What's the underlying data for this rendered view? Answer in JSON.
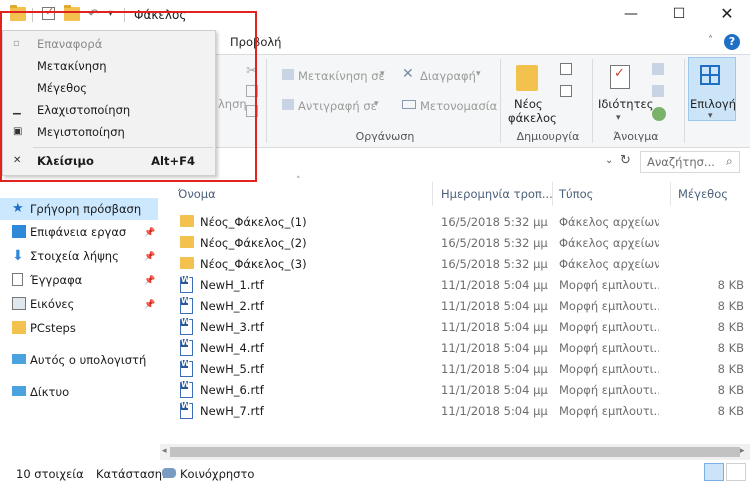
{
  "window": {
    "title": "Φάκελος"
  },
  "tabs": {
    "view": "Προβολή"
  },
  "ribbon": {
    "move_to": "Μετακίνηση σε",
    "copy_to": "Αντιγραφή σε",
    "delete": "Διαγραφή",
    "rename": "Μετονομασία",
    "organize": "Οργάνωση",
    "new_folder_l1": "Νέος",
    "new_folder_l2": "φάκελος",
    "create": "Δημιουργία",
    "properties": "Ιδιότητες",
    "open": "Άνοιγμα",
    "select": "Επιλογή",
    "partial_label": "ληση"
  },
  "search": {
    "placeholder": "Αναζήτησ..."
  },
  "nav": {
    "quick_access": "Γρήγορη πρόσβαση",
    "items": [
      {
        "label": "Επιφάνεια εργασ"
      },
      {
        "label": "Στοιχεία λήψης"
      },
      {
        "label": "Έγγραφα"
      },
      {
        "label": "Εικόνες"
      },
      {
        "label": "PCsteps"
      }
    ],
    "this_pc": "Αυτός ο υπολογιστή",
    "network": "Δίκτυο"
  },
  "columns": {
    "name": "Όνομα",
    "date": "Ημερομηνία τροπ...",
    "type": "Τύπος",
    "size": "Μέγεθος"
  },
  "files": [
    {
      "name": "Νέος_Φάκελος_(1)",
      "date": "16/5/2018 5:32 μμ",
      "type": "Φάκελος αρχείων",
      "size": "",
      "kind": "folder"
    },
    {
      "name": "Νέος_Φάκελος_(2)",
      "date": "16/5/2018 5:32 μμ",
      "type": "Φάκελος αρχείων",
      "size": "",
      "kind": "folder"
    },
    {
      "name": "Νέος_Φάκελος_(3)",
      "date": "16/5/2018 5:32 μμ",
      "type": "Φάκελος αρχείων",
      "size": "",
      "kind": "folder"
    },
    {
      "name": "NewH_1.rtf",
      "date": "11/1/2018 5:04 μμ",
      "type": "Μορφή εμπλουτι...",
      "size": "8 KB",
      "kind": "rtf"
    },
    {
      "name": "NewH_2.rtf",
      "date": "11/1/2018 5:04 μμ",
      "type": "Μορφή εμπλουτι...",
      "size": "8 KB",
      "kind": "rtf"
    },
    {
      "name": "NewH_3.rtf",
      "date": "11/1/2018 5:04 μμ",
      "type": "Μορφή εμπλουτι...",
      "size": "8 KB",
      "kind": "rtf"
    },
    {
      "name": "NewH_4.rtf",
      "date": "11/1/2018 5:04 μμ",
      "type": "Μορφή εμπλουτι...",
      "size": "8 KB",
      "kind": "rtf"
    },
    {
      "name": "NewH_5.rtf",
      "date": "11/1/2018 5:04 μμ",
      "type": "Μορφή εμπλουτι...",
      "size": "8 KB",
      "kind": "rtf"
    },
    {
      "name": "NewH_6.rtf",
      "date": "11/1/2018 5:04 μμ",
      "type": "Μορφή εμπλουτι...",
      "size": "8 KB",
      "kind": "rtf"
    },
    {
      "name": "NewH_7.rtf",
      "date": "11/1/2018 5:04 μμ",
      "type": "Μορφή εμπλουτι...",
      "size": "8 KB",
      "kind": "rtf"
    }
  ],
  "status": {
    "count": "10 στοιχεία",
    "state_label": "Κατάσταση:",
    "state_value": "Κοινόχρηστο"
  },
  "menu": {
    "restore": "Επαναφορά",
    "move": "Μετακίνηση",
    "size": "Μέγεθος",
    "minimize": "Ελαχιστοποίηση",
    "maximize": "Μεγιστοποίηση",
    "close": "Κλείσιμο",
    "close_shortcut": "Alt+F4"
  },
  "colors": {
    "accent": "#1f6fc5",
    "highlight_box": "#e0231f",
    "selection": "#cce8ff"
  }
}
